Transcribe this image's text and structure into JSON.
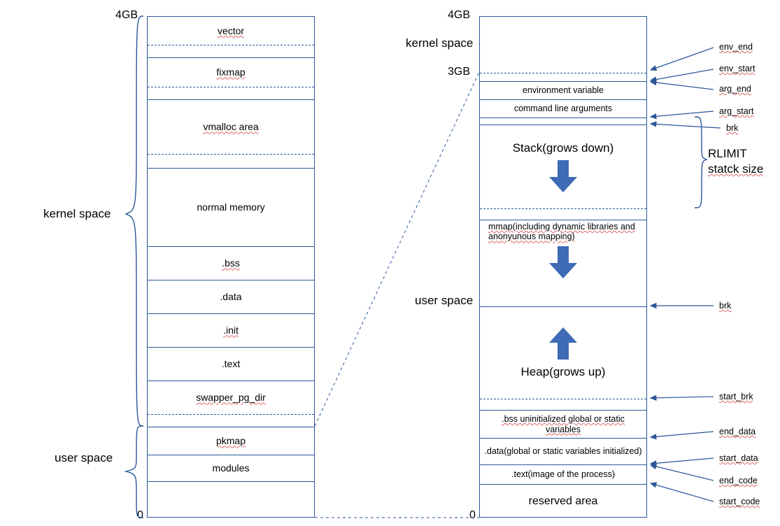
{
  "colors": {
    "line": "#2B579A",
    "arrow_fill": "#3F6BB5",
    "underline": "#E06666"
  },
  "left": {
    "top_label": "4GB",
    "bottom_label": "0",
    "kernel_label": "kernel space",
    "user_label": "user space",
    "cells": {
      "vector": "vector",
      "fixmap": "fixmap",
      "vmalloc": "vmalloc area",
      "normal": "normal memory",
      "bss": ".bss",
      "data": ".data",
      "init": ".init",
      "text": ".text",
      "swapper": "swapper_pg_dir",
      "pkmap": "pkmap",
      "modules": "modules"
    }
  },
  "right": {
    "top_label": "4GB",
    "three_label": "3GB",
    "bottom_label": "0",
    "kernel_label": "kernel space",
    "user_label": "user space",
    "cells": {
      "env": "environment variable",
      "args": "command line arguments",
      "stack": "Stack(grows down)",
      "mmap": "mmap(including dynamic libraries and anonyunous mapping)",
      "heap": "Heap(grows up)",
      "bss": ".bss uninitialized global or static variables",
      "data": ".data(global or static variables initialized)",
      "text": ".text(image of the process)",
      "reserved": "reserved area"
    },
    "pointers": {
      "env_end": "env_end",
      "env_start": "env_start",
      "arg_end": "arg_end",
      "arg_start": "arg_start",
      "brk_top": "brk",
      "rlimit_l1": "RLIMIT",
      "rlimit_l2": "statck size",
      "brk": "brk",
      "start_brk": "start_brk",
      "end_data": "end_data",
      "start_data": "start_data",
      "end_code": "end_code",
      "start_code": "start_code"
    }
  }
}
